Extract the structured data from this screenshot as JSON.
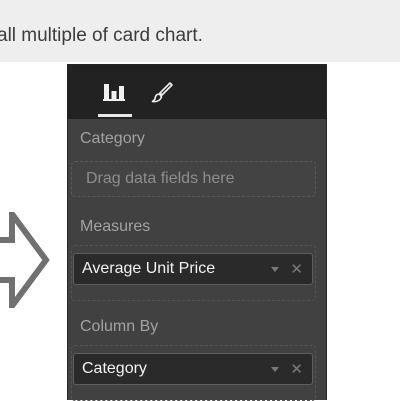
{
  "caption": "all multiple of card chart.",
  "panel": {
    "tabs": [
      {
        "name": "fields",
        "icon": "bar-chart-icon",
        "active": true
      },
      {
        "name": "format",
        "icon": "paint-brush-icon",
        "active": false
      }
    ],
    "sections": {
      "category": {
        "label": "Category",
        "placeholder": "Drag data fields here"
      },
      "measures": {
        "label": "Measures",
        "field": "Average Unit Price"
      },
      "column_by": {
        "label": "Column By",
        "field": "Category"
      }
    },
    "remove_glyph": "✕"
  }
}
